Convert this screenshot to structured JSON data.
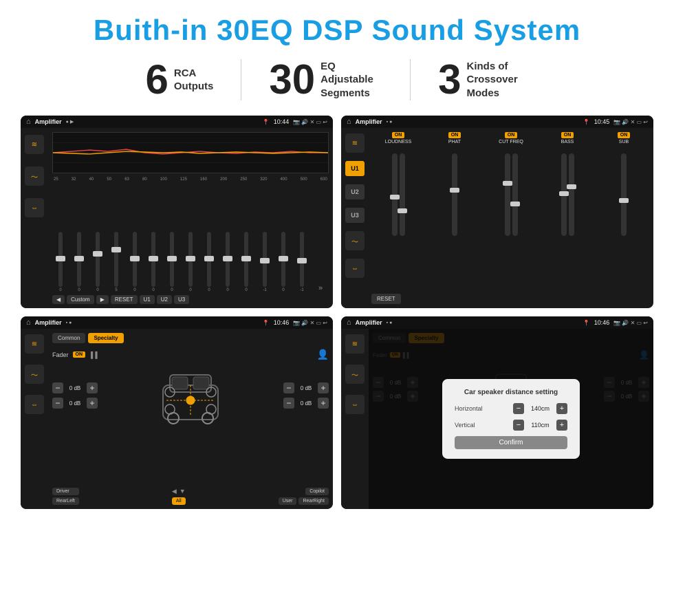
{
  "title": "Buith-in 30EQ DSP Sound System",
  "stats": [
    {
      "number": "6",
      "text_line1": "RCA",
      "text_line2": "Outputs"
    },
    {
      "number": "30",
      "text_line1": "EQ Adjustable",
      "text_line2": "Segments"
    },
    {
      "number": "3",
      "text_line1": "Kinds of",
      "text_line2": "Crossover Modes"
    }
  ],
  "screens": {
    "eq": {
      "app_name": "Amplifier",
      "time": "10:44",
      "freq_labels": [
        "25",
        "32",
        "40",
        "50",
        "63",
        "80",
        "100",
        "125",
        "160",
        "200",
        "250",
        "320",
        "400",
        "500",
        "630"
      ],
      "slider_values": [
        "0",
        "0",
        "0",
        "5",
        "0",
        "0",
        "0",
        "0",
        "0",
        "0",
        "0",
        "-1",
        "0",
        "-1"
      ],
      "buttons": [
        "◀",
        "Custom",
        "▶",
        "RESET",
        "U1",
        "U2",
        "U3"
      ],
      "eq_preset": "Custom"
    },
    "dsp": {
      "app_name": "Amplifier",
      "time": "10:45",
      "u_buttons": [
        "U1",
        "U2",
        "U3"
      ],
      "channels": [
        "LOUDNESS",
        "PHAT",
        "CUT FREQ",
        "BASS",
        "SUB"
      ],
      "on_labels": [
        "ON",
        "ON",
        "ON",
        "ON",
        "ON"
      ]
    },
    "fader": {
      "app_name": "Amplifier",
      "time": "10:46",
      "tabs": [
        "Common",
        "Specialty"
      ],
      "fader_label": "Fader",
      "on_badge": "ON",
      "db_values": [
        "0 dB",
        "0 dB",
        "0 dB",
        "0 dB"
      ],
      "bottom_labels": [
        "Driver",
        "",
        "Copilot",
        "RearLeft",
        "All",
        "",
        "User",
        "RearRight"
      ]
    },
    "dist": {
      "app_name": "Amplifier",
      "time": "10:46",
      "tabs": [
        "Common",
        "Specialty"
      ],
      "on_badge": "ON",
      "modal": {
        "title": "Car speaker distance setting",
        "horizontal_label": "Horizontal",
        "horizontal_value": "140cm",
        "vertical_label": "Vertical",
        "vertical_value": "110cm",
        "confirm_btn": "Confirm"
      },
      "db_values": [
        "0 dB",
        "0 dB"
      ],
      "bottom_labels": [
        "Driver",
        "",
        "Copilot",
        "RearLeft",
        "",
        "User",
        "RearRight"
      ]
    }
  },
  "icons": {
    "home": "⌂",
    "settings": "⚙",
    "back": "↩",
    "location": "📍",
    "volume": "🔊",
    "x": "✕",
    "minus": "▭",
    "eq_icon": "≋",
    "wave": "〜",
    "arrows": "⇔",
    "person": "👤",
    "car": "🚗"
  },
  "colors": {
    "accent": "#f0a000",
    "bg_dark": "#1a1a1a",
    "text_light": "#eeeeee",
    "blue_title": "#1a9ee3"
  }
}
